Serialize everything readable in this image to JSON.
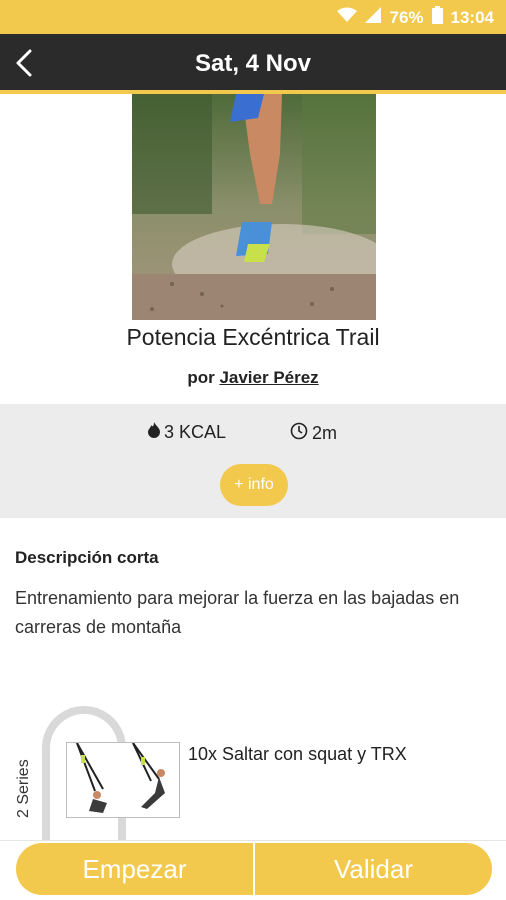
{
  "status_bar": {
    "battery": "76%",
    "time": "13:04",
    "icons": [
      "wifi-icon",
      "signal-icon",
      "battery-icon"
    ]
  },
  "app_bar": {
    "title": "Sat, 4 Nov",
    "back_icon": "back-arrow-icon"
  },
  "workout": {
    "title": "Potencia Excéntrica Trail",
    "author_prefix": "por",
    "author_name": "Javier Pérez"
  },
  "stats": {
    "kcal": "3 KCAL",
    "duration": "2m",
    "info_label": "+ info"
  },
  "description": {
    "heading": "Descripción corta",
    "text": "Entrenamiento para mejorar la fuerza en las bajadas en carreras de montaña"
  },
  "series": {
    "label": "2 Series",
    "exercise": "10x Saltar con squat y TRX"
  },
  "actions": {
    "start": "Empezar",
    "validate": "Validar"
  },
  "colors": {
    "accent": "#f2c94c",
    "appbar": "#2b2b2b"
  }
}
